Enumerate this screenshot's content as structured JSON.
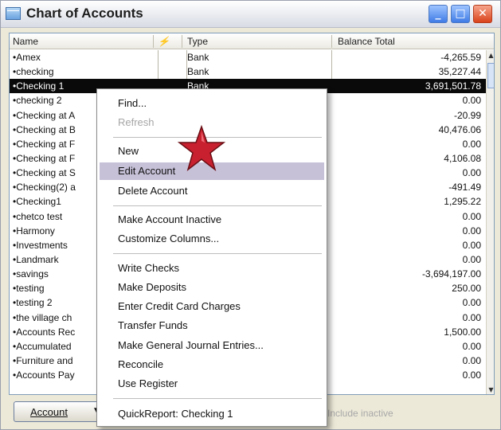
{
  "window": {
    "title": "Chart of Accounts",
    "controls": [
      "_",
      "□",
      "✕"
    ]
  },
  "columns": {
    "name": "Name",
    "flag": "⚡",
    "type": "Type",
    "balance": "Balance Total"
  },
  "rows": [
    {
      "name": "•Amex",
      "type": "Bank",
      "balance": "-4,265.59"
    },
    {
      "name": "•checking",
      "type": "Bank",
      "balance": "35,227.44"
    },
    {
      "name": "•Checking 1",
      "type": "Bank",
      "balance": "3,691,501.78"
    },
    {
      "name": "•checking 2",
      "type": "",
      "balance": "0.00"
    },
    {
      "name": "•Checking at A",
      "type": "",
      "balance": "-20.99"
    },
    {
      "name": "•Checking at B",
      "type": "",
      "balance": "40,476.06"
    },
    {
      "name": "•Checking at F",
      "type": "",
      "balance": "0.00"
    },
    {
      "name": "•Checking at F",
      "type": "",
      "balance": "4,106.08"
    },
    {
      "name": "•Checking at S",
      "type": "",
      "balance": "0.00"
    },
    {
      "name": "•Checking(2) a",
      "type": "",
      "balance": "-491.49"
    },
    {
      "name": "•Checking1",
      "type": "",
      "balance": "1,295.22"
    },
    {
      "name": "•chetco test",
      "type": "",
      "balance": "0.00"
    },
    {
      "name": "•Harmony",
      "type": "",
      "balance": "0.00"
    },
    {
      "name": "•Investments",
      "type": "",
      "balance": "0.00"
    },
    {
      "name": "•Landmark",
      "type": "",
      "balance": "0.00"
    },
    {
      "name": "•savings",
      "type": "",
      "balance": "-3,694,197.00"
    },
    {
      "name": "•testing",
      "type": "",
      "balance": "250.00"
    },
    {
      "name": "•testing 2",
      "type": "",
      "balance": "0.00"
    },
    {
      "name": "•the village ch",
      "type": "",
      "balance": "0.00"
    },
    {
      "name": "•Accounts Rec",
      "type": "",
      "balance": "1,500.00"
    },
    {
      "name": "•Accumulated",
      "type": "",
      "balance": "0.00"
    },
    {
      "name": "•Furniture and",
      "type": "",
      "balance": "0.00"
    },
    {
      "name": "•Accounts Pay",
      "type": "",
      "balance": "0.00"
    }
  ],
  "selected_row": 2,
  "scrollbar": {
    "up": "▲",
    "down": "▼"
  },
  "bottom": {
    "account_button": "Account",
    "account_arrow": "▼",
    "include_inactive": "Include inactive"
  },
  "menu": {
    "items": [
      {
        "label": "Find...",
        "enabled": true
      },
      {
        "label": "Refresh",
        "enabled": false
      },
      {
        "label": "New",
        "enabled": true
      },
      {
        "label": "Edit Account",
        "enabled": true
      },
      {
        "label": "Delete Account",
        "enabled": true
      },
      {
        "label": "Make Account Inactive",
        "enabled": true
      },
      {
        "label": "Customize Columns...",
        "enabled": true
      },
      {
        "label": "Write Checks",
        "enabled": true
      },
      {
        "label": "Make Deposits",
        "enabled": true
      },
      {
        "label": "Enter Credit Card Charges",
        "enabled": true
      },
      {
        "label": "Transfer Funds",
        "enabled": true
      },
      {
        "label": "Make General Journal Entries...",
        "enabled": true
      },
      {
        "label": "Reconcile",
        "enabled": true
      },
      {
        "label": "Use Register",
        "enabled": true
      },
      {
        "label": "QuickReport: Checking 1",
        "enabled": true
      }
    ],
    "highlighted_item": 3
  },
  "colors": {
    "selection": "#0a0a0a",
    "menu_highlight": "#c7c1d8",
    "star": "#c8202f"
  }
}
